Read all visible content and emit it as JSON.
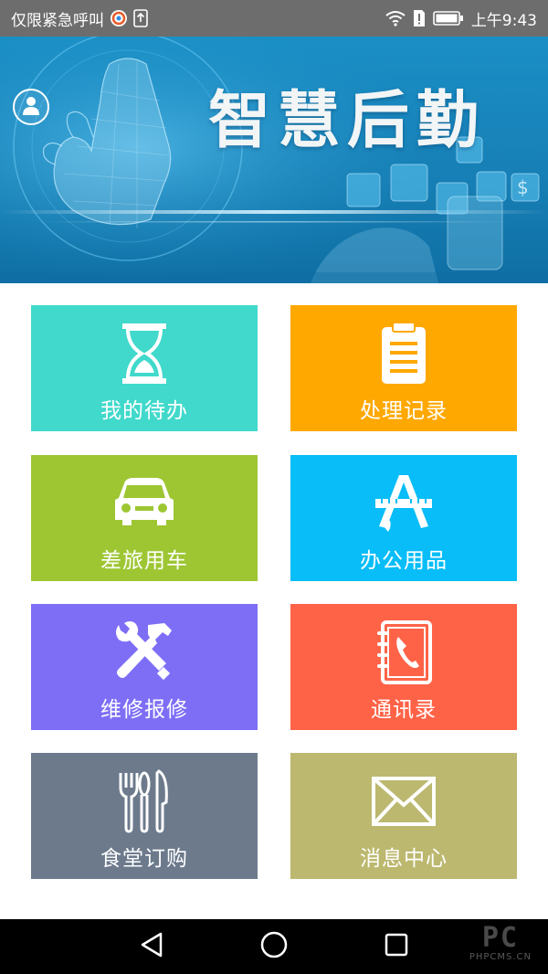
{
  "status_bar": {
    "left_text": "仅限紧急呼叫",
    "time": "上午9:43",
    "icons": [
      "browser-icon",
      "upload-icon",
      "wifi-icon",
      "sim-alert-icon",
      "battery-icon"
    ]
  },
  "banner": {
    "title": "智慧后勤"
  },
  "tiles": [
    {
      "label": "我的待办",
      "icon": "hourglass-icon",
      "color": "#40d9cb"
    },
    {
      "label": "处理记录",
      "icon": "clipboard-icon",
      "color": "#ffa800"
    },
    {
      "label": "差旅用车",
      "icon": "car-icon",
      "color": "#9dc632"
    },
    {
      "label": "办公用品",
      "icon": "stationery-icon",
      "color": "#08bdf8"
    },
    {
      "label": "维修报修",
      "icon": "tools-icon",
      "color": "#7d6ef5"
    },
    {
      "label": "通讯录",
      "icon": "phonebook-icon",
      "color": "#ff6347"
    },
    {
      "label": "食堂订购",
      "icon": "cutlery-icon",
      "color": "#6c7a8c"
    },
    {
      "label": "消息中心",
      "icon": "envelope-icon",
      "color": "#bcb86f"
    }
  ],
  "watermark": {
    "brand": "PC",
    "site": "PHPCMS.CN"
  }
}
